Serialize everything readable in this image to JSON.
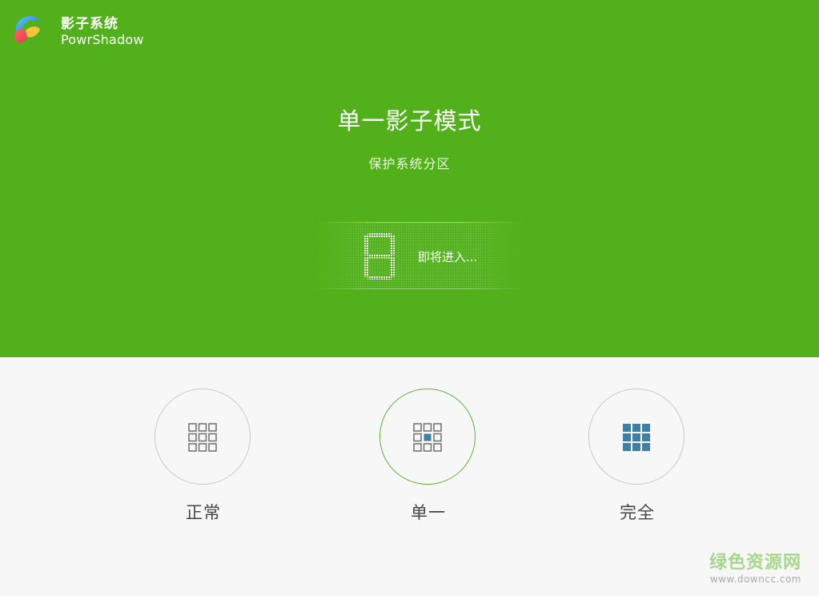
{
  "app": {
    "name_cn": "影子系统",
    "name_en": "PowrShadow"
  },
  "mode_panel": {
    "title": "单一影子模式",
    "subtitle": "保护系统分区",
    "countdown_digit": "8",
    "entering_text": "即将进入..."
  },
  "modes": [
    {
      "label": "正常",
      "icon": "grid-outline-icon",
      "selected": false
    },
    {
      "label": "单一",
      "icon": "grid-center-filled-icon",
      "selected": true
    },
    {
      "label": "完全",
      "icon": "grid-filled-icon",
      "selected": false
    }
  ],
  "watermark": {
    "text": "绿色资源网",
    "url": "www.downcc.com"
  },
  "colors": {
    "accent_green": "#52b11b",
    "selected_ring": "#5cb233",
    "icon_blue": "#3f7fa6",
    "icon_gray": "#777777"
  }
}
